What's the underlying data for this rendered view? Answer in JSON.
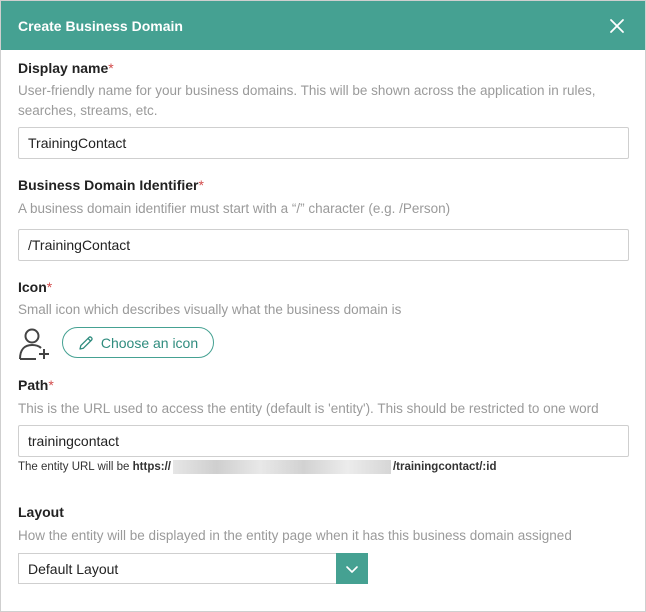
{
  "dialog": {
    "title": "Create Business Domain",
    "close_icon": "close-icon"
  },
  "display_name": {
    "label": "Display name",
    "required_mark": "*",
    "help": "User-friendly name for your business domains. This will be shown across the application in rules, searches, streams, etc.",
    "value": "TrainingContact"
  },
  "identifier": {
    "label": "Business Domain Identifier",
    "required_mark": "*",
    "help": "A business domain identifier must start with a “/” character (e.g. /Person)",
    "value": "/TrainingContact"
  },
  "icon": {
    "label": "Icon",
    "required_mark": "*",
    "help": "Small icon which describes visually what the business domain is",
    "preview_icon": "user-plus-icon",
    "choose_label": "Choose an icon",
    "choose_icon": "pencil-icon"
  },
  "path": {
    "label": "Path",
    "required_mark": "*",
    "help": "This is the URL used to access the entity (default is 'entity'). This should be restricted to one word",
    "value": "trainingcontact",
    "url_prefix": "The entity URL will be",
    "url_scheme": "https://",
    "url_suffix": "/trainingcontact/:id"
  },
  "layout": {
    "label": "Layout",
    "help": "How the entity will be displayed in the entity page when it has this business domain assigned",
    "selected": "Default Layout",
    "dropdown_icon": "chevron-down-icon"
  },
  "colors": {
    "header": "#45a192",
    "required": "#d24b4b",
    "help_text": "#9a9a9a"
  }
}
